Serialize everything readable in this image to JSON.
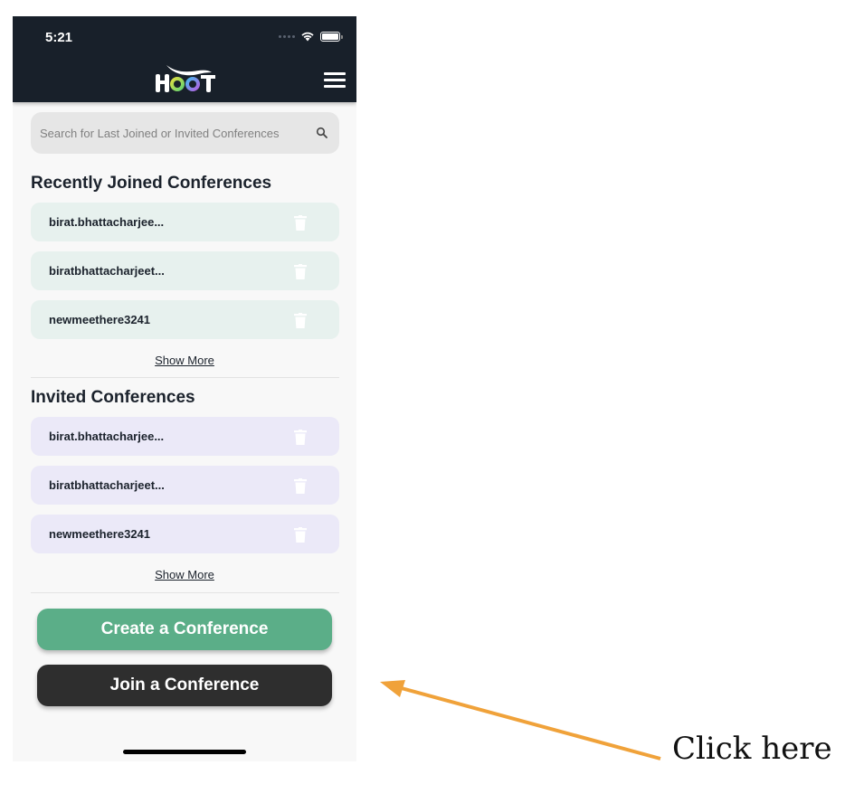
{
  "status_bar": {
    "time": "5:21"
  },
  "header": {
    "logo_alt": "HOOT",
    "menu_icon": "hamburger-menu-icon"
  },
  "search": {
    "placeholder": "Search for Last Joined or Invited Conferences",
    "value": "",
    "icon": "search-icon"
  },
  "recently_joined": {
    "title": "Recently Joined Conferences",
    "items": [
      {
        "name": "birat.bhattacharjee..."
      },
      {
        "name": "biratbhattacharjeet..."
      },
      {
        "name": "newmeethere3241"
      }
    ],
    "show_more_label": "Show More"
  },
  "invited": {
    "title": "Invited Conferences",
    "items": [
      {
        "name": "birat.bhattacharjee..."
      },
      {
        "name": "biratbhattacharjeet..."
      },
      {
        "name": "newmeethere3241"
      }
    ],
    "show_more_label": "Show More"
  },
  "actions": {
    "create_label": "Create a Conference",
    "join_label": "Join a Conference"
  },
  "annotation": {
    "text": "Click here",
    "arrow_color": "#f0a23a"
  },
  "colors": {
    "header_bg": "#18202a",
    "joined_item_bg": "#e7f1ee",
    "invited_item_bg": "#ebe9f8",
    "create_button": "#5bae88",
    "join_button": "#2e2e2e"
  }
}
